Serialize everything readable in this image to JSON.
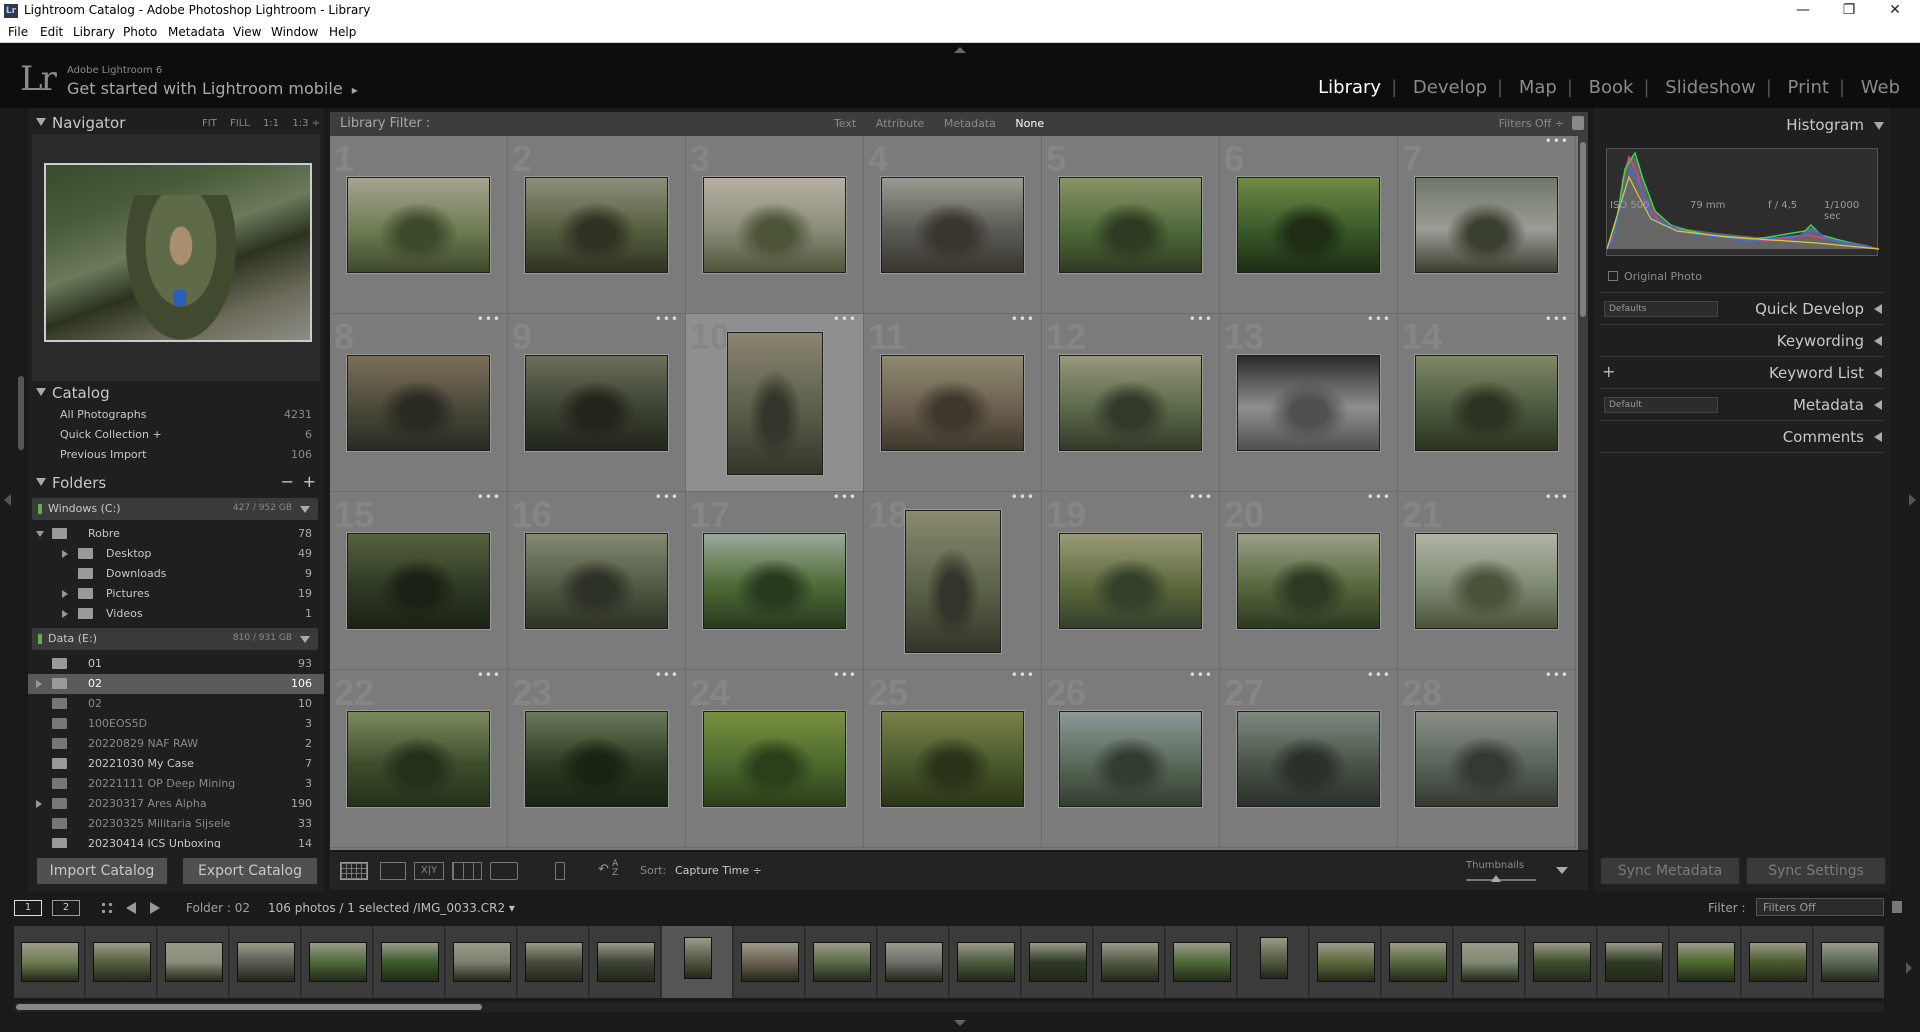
{
  "window": {
    "title": "Lightroom Catalog - Adobe Photoshop Lightroom - Library",
    "app_icon": "Lr",
    "buttons": [
      "minimize-icon",
      "maximize-icon",
      "close-icon"
    ]
  },
  "menu": [
    "File",
    "Edit",
    "Library",
    "Photo",
    "Metadata",
    "View",
    "Window",
    "Help"
  ],
  "identity": {
    "logo": "Lr",
    "version": "Adobe Lightroom 6",
    "mobile_label": "Get started with Lightroom mobile",
    "mobile_arrow": "▸"
  },
  "modules": [
    "Library",
    "Develop",
    "Map",
    "Book",
    "Slideshow",
    "Print",
    "Web"
  ],
  "active_module": "Library",
  "navigator": {
    "label": "Navigator",
    "zoom_options": [
      "FIT",
      "FILL",
      "1:1",
      "1:3 ÷"
    ]
  },
  "catalog": {
    "label": "Catalog",
    "items": [
      {
        "name": "All Photographs",
        "count": "4231"
      },
      {
        "name": "Quick Collection +",
        "count": "6"
      },
      {
        "name": "Previous Import",
        "count": "106"
      }
    ]
  },
  "folders": {
    "label": "Folders",
    "minus": "−",
    "plus": "+",
    "volumes": [
      {
        "name": "Windows (C:)",
        "size": "427 / 952 GB"
      },
      {
        "name": "Data (E:)",
        "size": "810 / 931 GB"
      }
    ],
    "c_items": [
      {
        "name": "Robre",
        "count": "78"
      },
      {
        "name": "Desktop",
        "count": "49"
      },
      {
        "name": "Downloads",
        "count": "9"
      },
      {
        "name": "Pictures",
        "count": "19"
      },
      {
        "name": "Videos",
        "count": "1"
      }
    ],
    "e_items": [
      {
        "name": "01",
        "count": "93"
      },
      {
        "name": "02",
        "count": "106"
      },
      {
        "name": "02",
        "count": "10"
      },
      {
        "name": "100EOS5D",
        "count": "3"
      },
      {
        "name": "20220829 NAF RAW",
        "count": "2"
      },
      {
        "name": "20221030 My Case",
        "count": "7"
      },
      {
        "name": "20221111 OP Deep Mining",
        "count": "3"
      },
      {
        "name": "20230317 Ares Alpha",
        "count": "190"
      },
      {
        "name": "20230325 Militaria Sijsele",
        "count": "33"
      },
      {
        "name": "20230414 ICS Unboxing",
        "count": "14"
      }
    ]
  },
  "left_buttons": {
    "import": "Import Catalog",
    "export": "Export Catalog"
  },
  "filter_bar": {
    "label": "Library Filter :",
    "options": [
      "Text",
      "Attribute",
      "Metadata",
      "None"
    ],
    "active": "None",
    "filters_off": "Filters Off ÷"
  },
  "grid_numbers": [
    "1",
    "2",
    "3",
    "4",
    "5",
    "6",
    "7",
    "8",
    "9",
    "10",
    "11",
    "12",
    "13",
    "14",
    "15",
    "16",
    "17",
    "18",
    "19",
    "20",
    "21",
    "22",
    "23",
    "24",
    "25",
    "26",
    "27",
    "28"
  ],
  "toolbar": {
    "sort_label": "Sort:",
    "sort_value": "Capture Time ÷",
    "thumbnails_label": "Thumbnails"
  },
  "right_panel": {
    "histogram_label": "Histogram",
    "histogram_info": {
      "iso": "ISO 500",
      "focal": "79 mm",
      "aperture": "f / 4,5",
      "shutter": "1/1000 sec"
    },
    "original_photo": "Original Photo",
    "quick_develop": {
      "label": "Quick Develop",
      "preset": "Defaults"
    },
    "keywording": "Keywording",
    "keyword_list": "Keyword List",
    "metadata": {
      "label": "Metadata",
      "preset": "Default"
    },
    "comments": "Comments"
  },
  "right_buttons": {
    "sync_metadata": "Sync Metadata",
    "sync_settings": "Sync Settings"
  },
  "filmstrip_header": {
    "screen1": "1",
    "screen2": "2",
    "source": "Folder : 02",
    "info": "106 photos / 1 selected /IMG_0033.CR2 ▾",
    "filter_label": "Filter :",
    "filter_value": "Filters Off"
  },
  "colors": {
    "background": "#1a1a1a",
    "panel": "#1f1f1f",
    "grid": "#7b7b7b",
    "accent_white": "#ffffff"
  }
}
